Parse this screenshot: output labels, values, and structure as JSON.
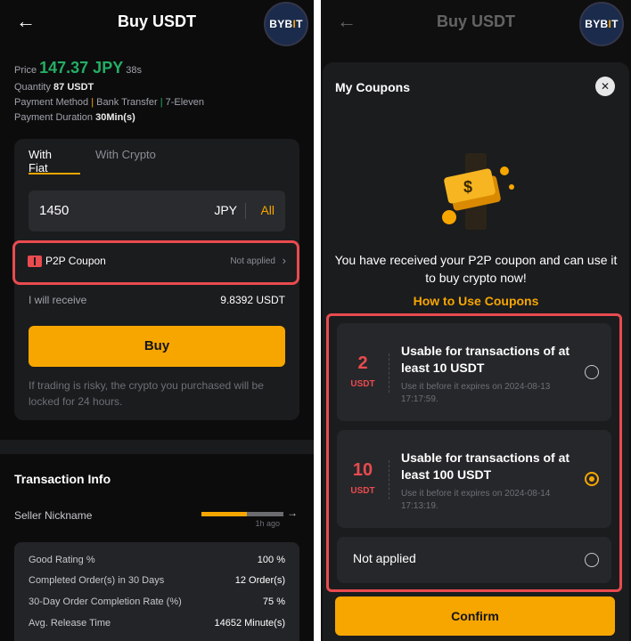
{
  "left": {
    "header": {
      "back": "←",
      "title": "Buy USDT",
      "logo_a": "BYB",
      "logo_bar": "I",
      "logo_b": "T"
    },
    "summary": {
      "price_label": "Price",
      "price_value": "147.37 JPY",
      "countdown": "38s",
      "quantity_label": "Quantity",
      "quantity_value": "87 USDT",
      "payment_label": "Payment Method",
      "payment_1": "Bank Transfer",
      "payment_2": "7-Eleven",
      "duration_label": "Payment Duration",
      "duration_value": "30Min(s)"
    },
    "trade": {
      "tab_fiat": "With Fiat",
      "tab_crypto": "With Crypto",
      "amount": "1450",
      "currency": "JPY",
      "all": "All",
      "coupon_label": "P2P Coupon",
      "coupon_status": "Not applied",
      "receive_label": "I will receive",
      "receive_value": "9.8392 USDT",
      "buy_label": "Buy",
      "risk_note": "If trading is risky, the crypto you purchased will be locked for 24 hours."
    },
    "info": {
      "title": "Transaction Info",
      "seller_label": "Seller Nickname",
      "seller_time": "1h ago",
      "seller_progress": 0.55,
      "stats": [
        {
          "label": "Good Rating %",
          "value": "100 %"
        },
        {
          "label": "Completed Order(s) in 30 Days",
          "value": "12 Order(s)"
        },
        {
          "label": "30-Day Order Completion Rate (%)",
          "value": "75 %"
        },
        {
          "label": "Avg. Release Time",
          "value": "14652 Minute(s)"
        }
      ]
    }
  },
  "right": {
    "header": {
      "back": "←",
      "title": "Buy USDT",
      "logo_a": "BYB",
      "logo_bar": "I",
      "logo_b": "T"
    },
    "sheet": {
      "title": "My Coupons",
      "close": "✕",
      "message": "You have received your P2P coupon and can use it to buy crypto now!",
      "howto": "How to Use Coupons",
      "coupons": [
        {
          "amount": "2",
          "unit": "USDT",
          "desc": "Usable for transactions of at least 10 USDT",
          "expiry": "Use it before it expires on 2024-08-13 17:17:59.",
          "selected": false
        },
        {
          "amount": "10",
          "unit": "USDT",
          "desc": "Usable for transactions of at least 100 USDT",
          "expiry": "Use it before it expires on 2024-08-14 17:13:19.",
          "selected": true
        }
      ],
      "not_applied": "Not applied",
      "confirm": "Confirm"
    }
  },
  "colors": {
    "accent": "#f7a600",
    "price_green": "#24ae64",
    "highlight_red": "#e94b4f",
    "background": "#0c0c0d"
  }
}
